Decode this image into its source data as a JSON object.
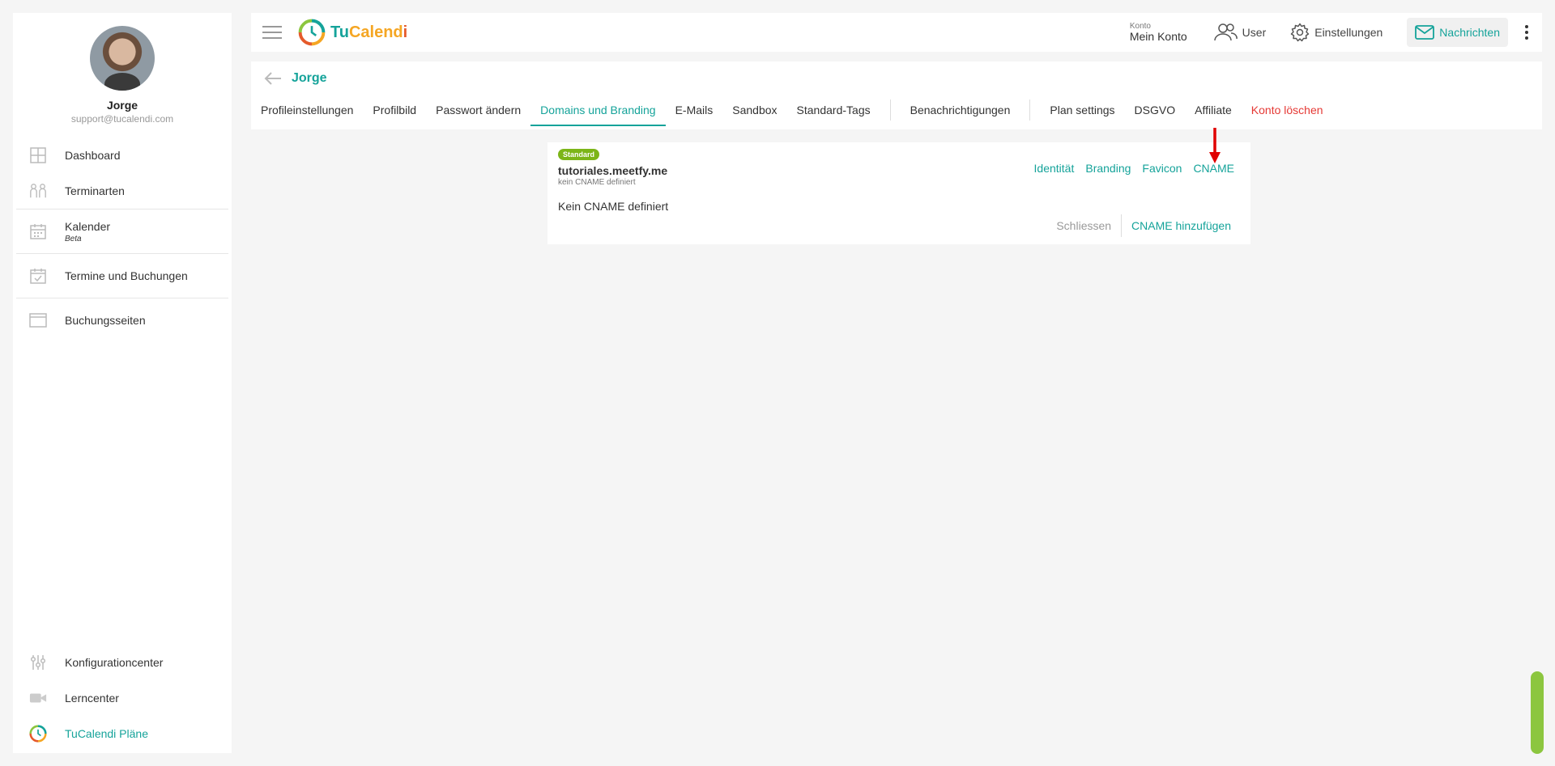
{
  "sidebar": {
    "user_name": "Jorge",
    "user_email": "support@tucalendi.com",
    "items": [
      {
        "label": "Dashboard"
      },
      {
        "label": "Terminarten"
      },
      {
        "label": "Kalender",
        "sub": "Beta"
      },
      {
        "label": "Termine und Buchungen"
      },
      {
        "label": "Buchungsseiten"
      }
    ],
    "bottom_items": [
      {
        "label": "Konfigurationcenter"
      },
      {
        "label": "Lerncenter"
      },
      {
        "label": "TuCalendi Pläne"
      }
    ]
  },
  "topbar": {
    "logo": {
      "part1": "Tu",
      "part2": "Calend",
      "part3": "i"
    },
    "konto_label": "Konto",
    "konto_value": "Mein Konto",
    "user_label": "User",
    "settings_label": "Einstellungen",
    "messages_label": "Nachrichten"
  },
  "header": {
    "title": "Jorge",
    "tabs": [
      {
        "label": "Profileinstellungen"
      },
      {
        "label": "Profilbild"
      },
      {
        "label": "Passwort ändern"
      },
      {
        "label": "Domains und Branding",
        "active": true
      },
      {
        "label": "E-Mails"
      },
      {
        "label": "Sandbox"
      },
      {
        "label": "Standard-Tags"
      },
      {
        "label": "Benachrichtigungen"
      },
      {
        "label": "Plan settings"
      },
      {
        "label": "DSGVO"
      },
      {
        "label": "Affiliate"
      },
      {
        "label": "Konto löschen"
      }
    ]
  },
  "card": {
    "badge": "Standard",
    "domain": "tutoriales.meetfy.me",
    "domain_status": "kein CNAME definiert",
    "links": [
      "Identität",
      "Branding",
      "Favicon",
      "CNAME"
    ],
    "message": "Kein CNAME definiert",
    "close_label": "Schliessen",
    "add_label": "CNAME hinzufügen"
  },
  "colors": {
    "accent": "#15a39a",
    "danger": "#e53935",
    "badge": "#7cb518",
    "arrow": "#e00000"
  }
}
